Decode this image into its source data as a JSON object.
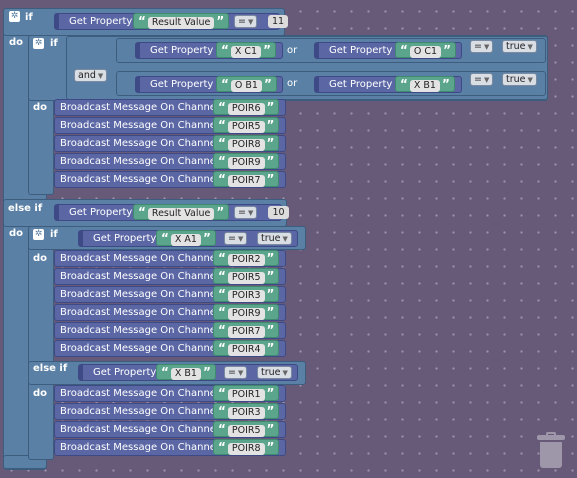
{
  "keywords": {
    "if": "if",
    "do": "do",
    "else_if": "else if",
    "and": "and",
    "get_property": "Get Property",
    "broadcast": "Broadcast Message On Channel",
    "or": "or",
    "eq": "=",
    "open_quote": "“",
    "close_quote": "”"
  },
  "block1": {
    "prop": "Result Value",
    "value": "11",
    "row1": {
      "left": "X C1",
      "right": "O C1",
      "cmp": "true"
    },
    "row2": {
      "left": "O B1",
      "right": "X B1",
      "cmp": "true"
    },
    "messages": [
      "POIR6",
      "POIR5",
      "POIR8",
      "POIR9",
      "POIR7"
    ]
  },
  "block2": {
    "prop": "Result Value",
    "value": "10",
    "inner_if": {
      "prop": "X A1",
      "cmp": "true",
      "messages": [
        "POIR2",
        "POIR5",
        "POIR3",
        "POIR9",
        "POIR7",
        "POIR4"
      ]
    },
    "inner_elseif": {
      "prop": "X B1",
      "cmp": "true",
      "messages": [
        "POIR1",
        "POIR3",
        "POIR5",
        "POIR8"
      ]
    }
  },
  "colors": {
    "workspace": "#675a78",
    "logic": "#5b80a5",
    "text_block": "#5ba58c",
    "procedure": "#5b67a5"
  },
  "icons": {
    "gear": "gear-icon",
    "trash": "trash-icon"
  }
}
